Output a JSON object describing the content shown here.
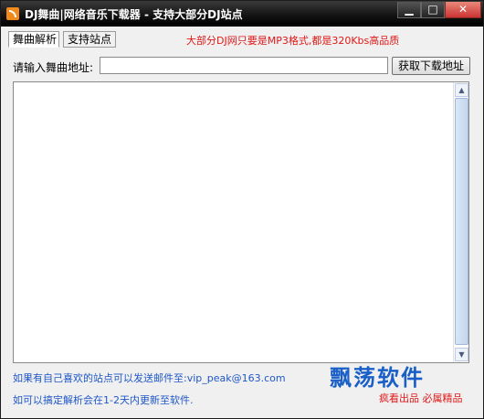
{
  "window": {
    "title": "DJ舞曲|网络音乐下载器 - 支持大部分DJ站点",
    "controls": {
      "minimize": "▁",
      "maximize": "□",
      "close": "✕"
    }
  },
  "tabs": [
    {
      "label": "舞曲解析",
      "active": true
    },
    {
      "label": "支持站点",
      "active": false
    }
  ],
  "notice": "大部分DJ网只要是MP3格式,都是320Kbs高品质",
  "form": {
    "url_label": "请输入舞曲地址:",
    "url_value": "",
    "fetch_button": "获取下载地址"
  },
  "scrollbar": {
    "up_icon": "▲",
    "down_icon": "▼"
  },
  "footer": {
    "line1": "如果有自己喜欢的站点可以发送邮件至:vip_peak@163.com",
    "line2": "如可以搞定解析会在1-2天内更新至软件.",
    "brand": "飘荡软件",
    "slogan": "疯看出品 必属精品"
  },
  "colors": {
    "notice": "#e01818",
    "link_text": "#1f57c7",
    "brand": "#1a5fc8"
  }
}
